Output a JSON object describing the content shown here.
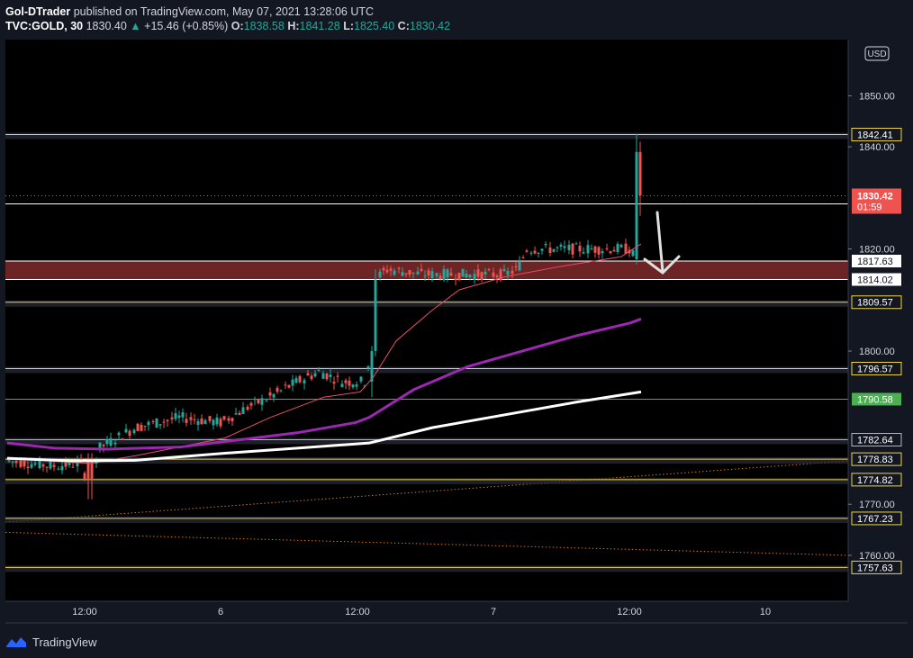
{
  "header": {
    "author": "Gol-DTrader",
    "published_text": "published on TradingView.com, May 07, 2021 13:28:06 UTC",
    "symbol": "TVC:GOLD, 30",
    "last": "1830.40",
    "change_arrow": "▲",
    "change": "+15.46 (+0.85%)",
    "o_label": "O:",
    "o": "1838.58",
    "h_label": "H:",
    "h": "1841.28",
    "l_label": "L:",
    "l": "1825.40",
    "c_label": "C:",
    "c": "1830.42"
  },
  "footer": {
    "brand": "TradingView"
  },
  "currency_badge": "USD",
  "chart_data": {
    "type": "candlestick",
    "y_range": [
      1751,
      1861
    ],
    "y_ticks": [
      "1850.00",
      "1840.00",
      "1820.00",
      "1800.00",
      "1770.00",
      "1760.00"
    ],
    "x_ticks": [
      "12:00",
      "6",
      "12:00",
      "7",
      "12:00",
      "10"
    ],
    "current_price": {
      "label": "1830.42",
      "countdown": "01:59",
      "value": 1830.42
    },
    "levels": [
      {
        "value": 1842.41,
        "label": "1842.41",
        "color": "#f0d44a",
        "style": "yellow"
      },
      {
        "value": 1828.83,
        "label": "1828.83",
        "color": "#ffffff",
        "style": "white"
      },
      {
        "value": 1817.63,
        "label": "1817.63",
        "color": "#ffffff",
        "style": "white"
      },
      {
        "value": 1814.02,
        "label": "1814.02",
        "color": "#ffffff",
        "style": "white"
      },
      {
        "value": 1809.57,
        "label": "1809.57",
        "color": "#f0d44a",
        "style": "yellow"
      },
      {
        "value": 1796.57,
        "label": "1796.57",
        "color": "#f0d44a",
        "style": "yellow"
      },
      {
        "value": 1790.58,
        "label": "1790.58",
        "color": "#4caf50",
        "style": "green"
      },
      {
        "value": 1782.64,
        "label": "1782.64",
        "color": "#b2b5be",
        "style": "grey"
      },
      {
        "value": 1778.83,
        "label": "1778.83",
        "color": "#f0d44a",
        "style": "yellow"
      },
      {
        "value": 1774.82,
        "label": "1774.82",
        "color": "#f0d44a",
        "style": "yellow"
      },
      {
        "value": 1767.23,
        "label": "1767.23",
        "color": "#f0d44a",
        "style": "yellow"
      },
      {
        "value": 1757.63,
        "label": "1757.63",
        "color": "#f0d44a",
        "style": "yellow"
      }
    ],
    "zone": {
      "top": 1817.63,
      "bottom": 1814.02,
      "color": "#7f2a2a"
    },
    "colors": {
      "up": "#26a69a",
      "down": "#ef5350",
      "ma_fast": "#e84e6a",
      "ma_mid": "#9c27b0",
      "ma_slow": "#ffffff",
      "trend": "#c57a2c"
    }
  }
}
